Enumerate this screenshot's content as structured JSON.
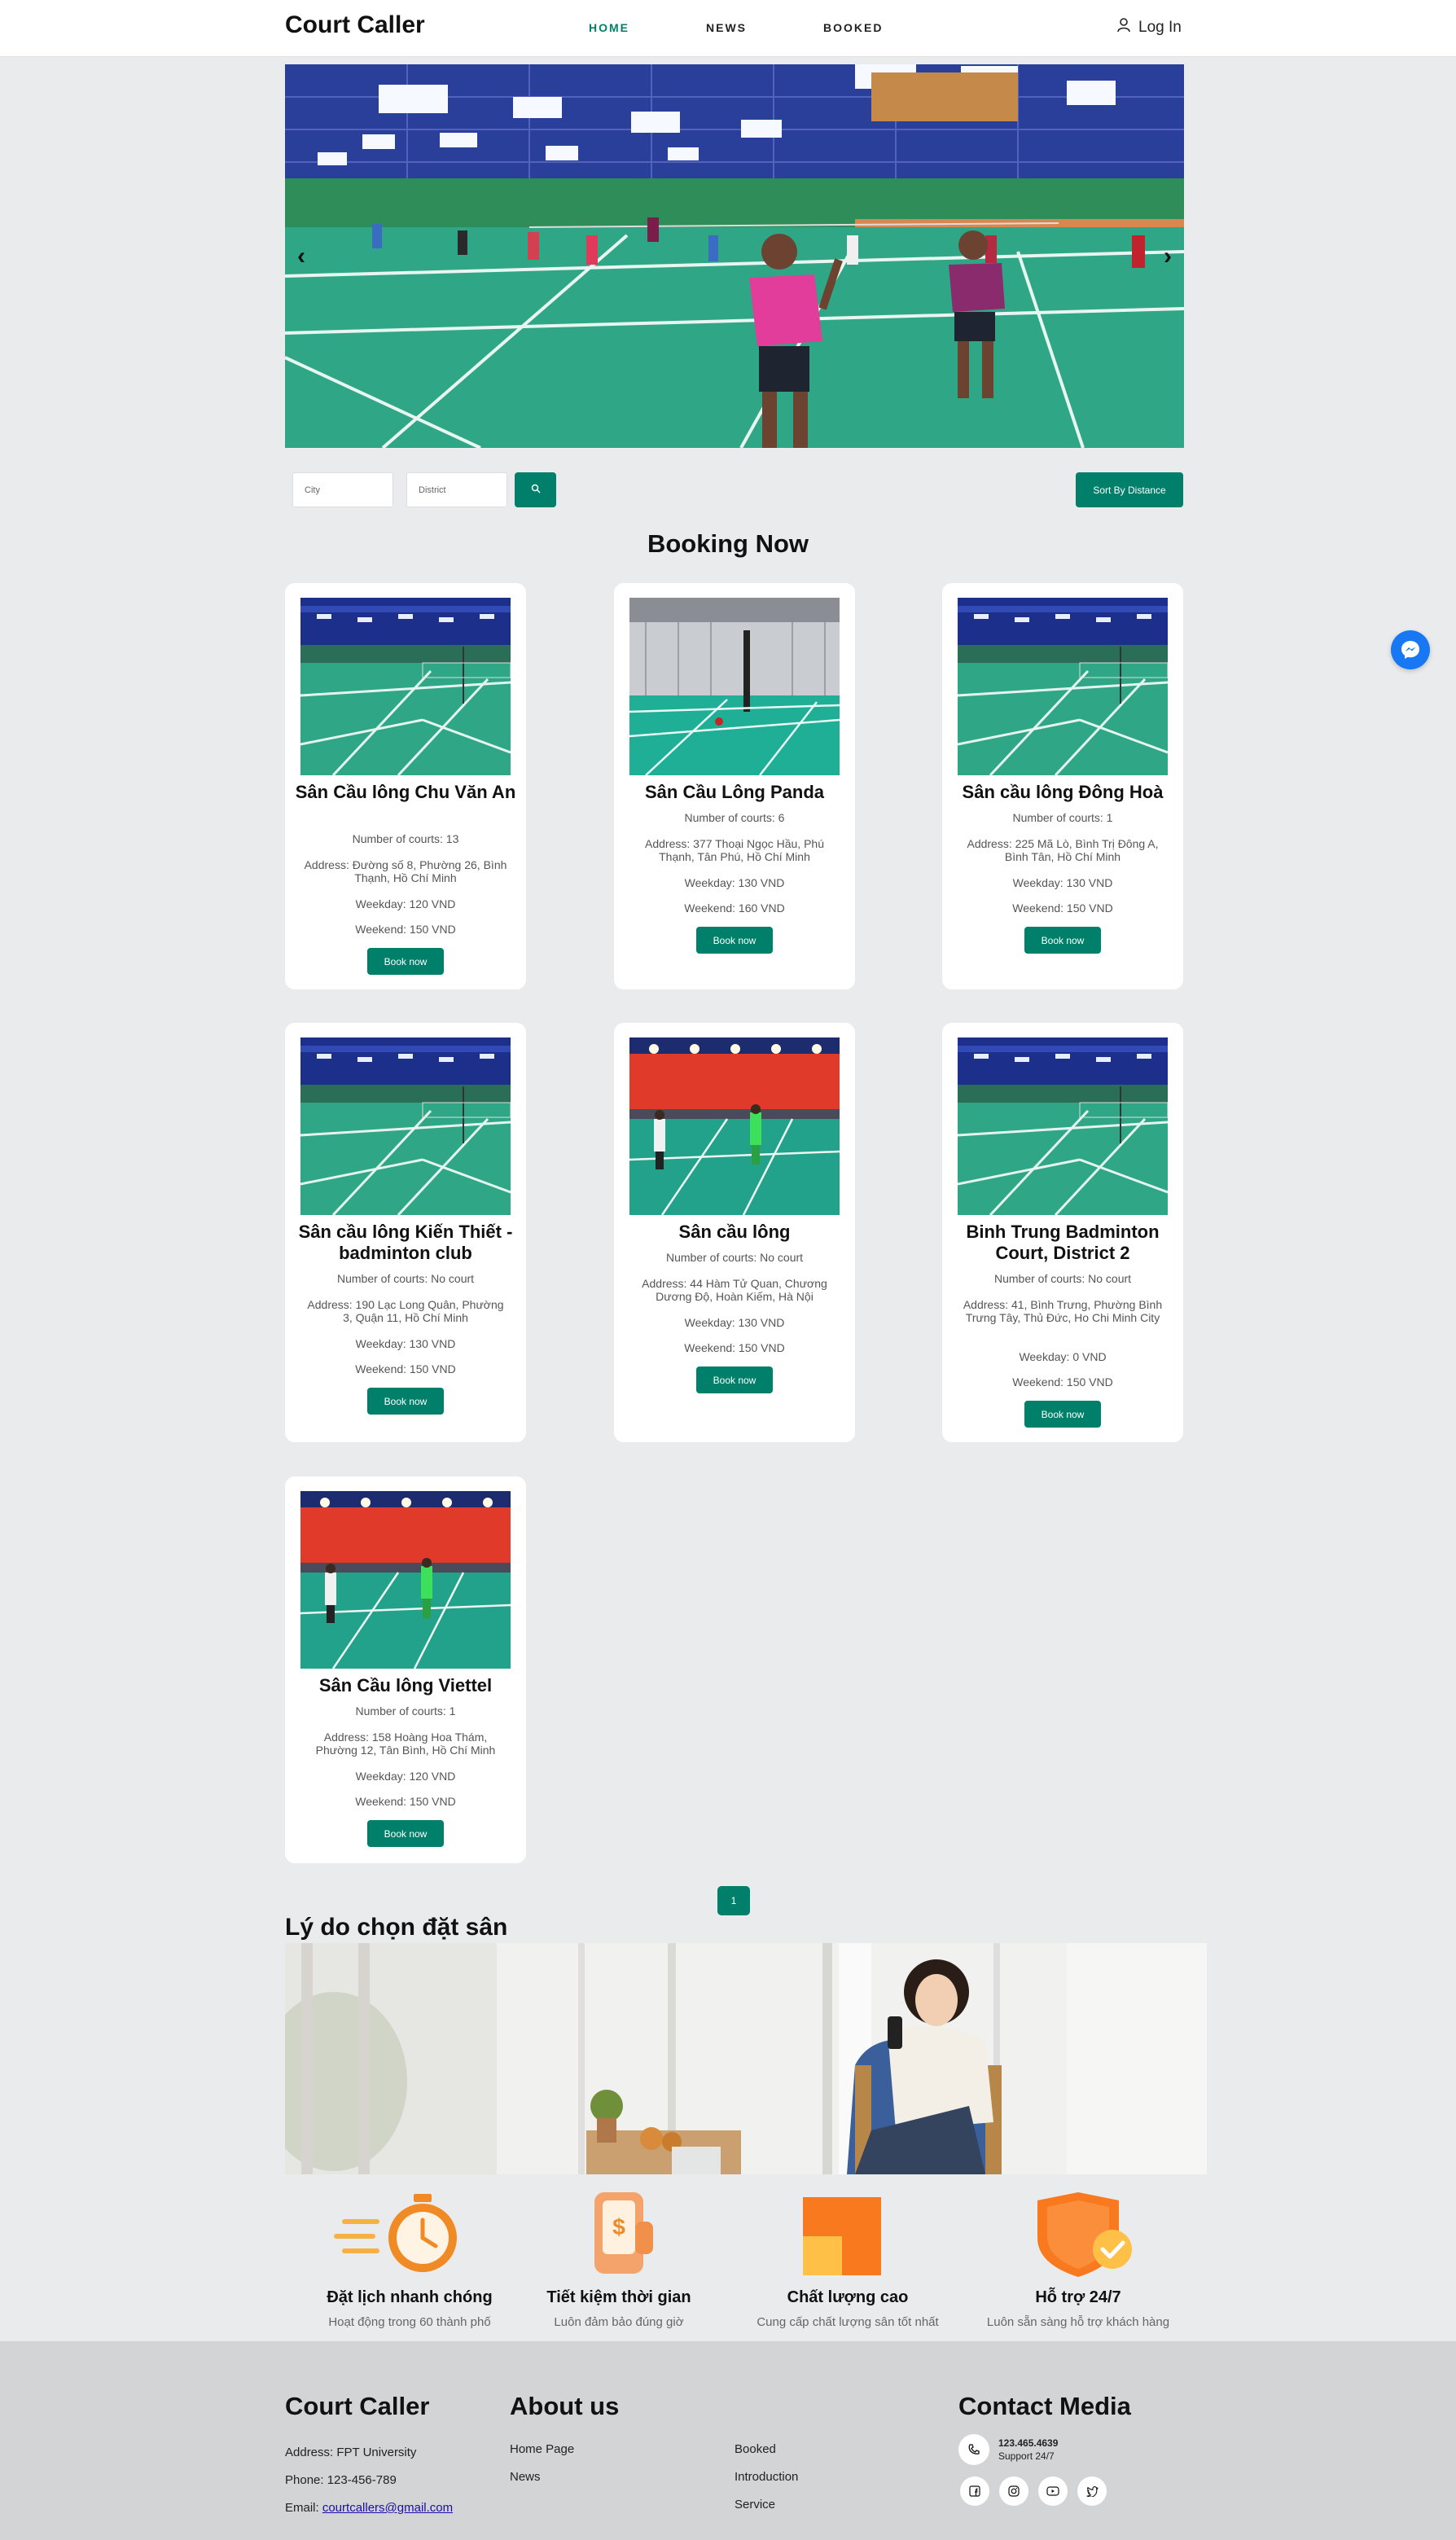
{
  "header": {
    "logo": "Court Caller",
    "nav": [
      "HOME",
      "NEWS",
      "BOOKED"
    ],
    "login": "Log In",
    "login_icon": "user-icon"
  },
  "filters": {
    "city_placeholder": "City",
    "district_placeholder": "District",
    "search_icon": "search-icon",
    "sort_label": "Sort By Distance"
  },
  "section_title": "Booking Now",
  "courts": [
    {
      "name": "Sân Cầu lông Chu Văn An",
      "courts": "Number of courts: 13",
      "address": "Address: Đường số 8, Phường 26, Bình Thạnh, Hồ Chí Minh",
      "weekday": "Weekday: 120 VND",
      "weekend": "Weekend: 150 VND",
      "button": "Book now"
    },
    {
      "name": "Sân Cầu Lông Panda",
      "courts": "Number of courts: 6",
      "address": "Address: 377 Thoại Ngọc Hầu, Phú Thạnh, Tân Phú, Hồ Chí Minh",
      "weekday": "Weekday: 130 VND",
      "weekend": "Weekend: 160 VND",
      "button": "Book now"
    },
    {
      "name": "Sân cầu lông Đông Hoà",
      "courts": "Number of courts: 1",
      "address": "Address: 225 Mã Lò, Bình Trị Đông A, Bình Tân, Hồ Chí Minh",
      "weekday": "Weekday: 130 VND",
      "weekend": "Weekend: 150 VND",
      "button": "Book now"
    },
    {
      "name": "Sân cầu lông Kiến Thiết - badminton club",
      "courts": "Number of courts: No court",
      "address": "Address: 190 Lạc Long Quân, Phường 3, Quận 11, Hồ Chí Minh",
      "weekday": "Weekday: 130 VND",
      "weekend": "Weekend: 150 VND",
      "button": "Book now"
    },
    {
      "name": "Sân cầu lông",
      "courts": "Number of courts: No court",
      "address": "Address: 44 Hàm Tử Quan, Chương Dương Độ, Hoàn Kiếm, Hà Nội",
      "weekday": "Weekday: 130 VND",
      "weekend": "Weekend: 150 VND",
      "button": "Book now"
    },
    {
      "name": "Binh Trung Badminton Court, District 2",
      "courts": "Number of courts: No court",
      "address": "Address: 41, Bình Trưng, Phường Bình Trưng Tây, Thủ Đức, Ho Chi Minh City",
      "weekday": "Weekday: 0 VND",
      "weekend": "Weekend: 150 VND",
      "button": "Book now"
    },
    {
      "name": "Sân Cầu lông Viettel",
      "courts": "Number of courts: 1",
      "address": "Address: 158 Hoàng Hoa Thám, Phường 12, Tân Bình, Hồ Chí Minh",
      "weekday": "Weekday: 120 VND",
      "weekend": "Weekend: 150 VND",
      "button": "Book now"
    }
  ],
  "pagination": {
    "current": "1"
  },
  "why": {
    "title": "Lý do chọn đặt sân",
    "features": [
      {
        "icon": "stopwatch-icon",
        "title": "Đặt lịch nhanh chóng",
        "desc": "Hoạt động trong 60 thành phố"
      },
      {
        "icon": "phone-money-icon",
        "title": "Tiết kiệm thời gian",
        "desc": "Luôn đảm bảo đúng giờ"
      },
      {
        "icon": "quality-square-icon",
        "title": "Chất lượng cao",
        "desc": "Cung cấp chất lượng sân tốt nhất"
      },
      {
        "icon": "shield-check-icon",
        "title": "Hỗ trợ 24/7",
        "desc": "Luôn sẵn sàng hỗ trợ khách hàng"
      }
    ]
  },
  "footer": {
    "brand": "Court Caller",
    "address": "Address: FPT University",
    "phone": "Phone: 123-456-789",
    "email_label": "Email: ",
    "email": "courtcallers@gmail.com",
    "about_title": "About us",
    "links_col1": [
      "Home Page",
      "News"
    ],
    "links_col2": [
      "Booked",
      "Introduction",
      "Service"
    ],
    "contact_title": "Contact Media",
    "contact_phone": "123.465.4639",
    "contact_support": "Support 24/7",
    "social_icons": [
      "facebook-icon",
      "instagram-icon",
      "youtube-icon",
      "twitter-icon"
    ]
  },
  "floating": {
    "icon": "messenger-icon"
  },
  "colors": {
    "accent": "#00806a",
    "background": "#eaebed",
    "footer": "#d3d4d6",
    "messenger": "#1877f2"
  }
}
